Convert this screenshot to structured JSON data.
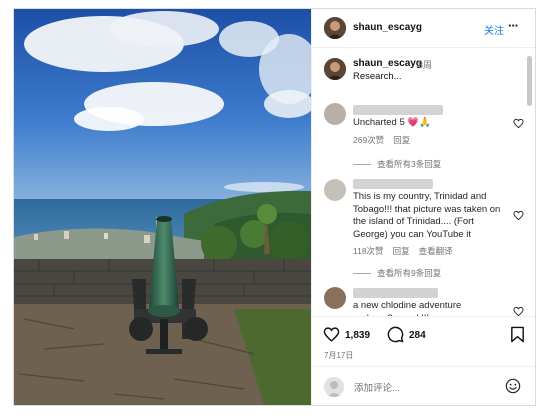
{
  "post": {
    "username": "shaun_escayg",
    "follow_label": "关注",
    "more_label": "···"
  },
  "caption": {
    "username": "shaun_escayg",
    "age": "8周",
    "text": "Research..."
  },
  "comments": [
    {
      "text": "Uncharted 5 💗🙏",
      "likes": "269次赞",
      "reply_label": "回复",
      "view_replies": "查看所有3条回复"
    },
    {
      "text": "This is my country, Trinidad and Tobago!!! that picture was taken on the island of Trinidad.... (Fort George) you can YouTube it",
      "likes": "118次赞",
      "reply_label": "回复",
      "translate_label": "查看翻译",
      "view_replies": "查看所有9条回复"
    },
    {
      "text": "a new chlodine adventure perhaps?.... eek!!!"
    }
  ],
  "actions": {
    "like_count": "1,839",
    "comment_count": "284",
    "date": "7月17日"
  },
  "composer": {
    "placeholder": "添加评论..."
  },
  "icons": [
    "heart-icon",
    "comment-icon",
    "bookmark-icon",
    "emoji-icon",
    "more-icon"
  ],
  "colors": {
    "link": "#1877f2",
    "secondary_text": "#737373",
    "border": "#dbdbdb"
  }
}
